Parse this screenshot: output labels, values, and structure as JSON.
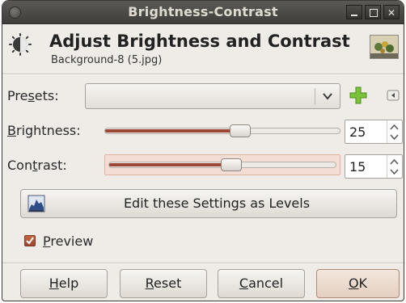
{
  "window": {
    "title": "Brightness-Contrast"
  },
  "header": {
    "title": "Adjust Brightness and Contrast",
    "subtitle": "Background-8 (5.jpg)"
  },
  "presets": {
    "label_pre": "Pre",
    "label_mnemonic": "s",
    "label_post": "ets:",
    "value": ""
  },
  "brightness": {
    "label_mnemonic": "B",
    "label_post": "rightness:",
    "value": "25",
    "min": -127,
    "max": 127
  },
  "contrast": {
    "label_pre": "Con",
    "label_mnemonic": "t",
    "label_post": "rast:",
    "value": "15",
    "min": -127,
    "max": 127
  },
  "levels_button": {
    "label": "Edit these Settings as Levels"
  },
  "preview": {
    "label_mnemonic": "P",
    "label_post": "review",
    "checked": true
  },
  "buttons": {
    "help_mnemonic": "H",
    "help_post": "elp",
    "reset_mnemonic": "R",
    "reset_post": "eset",
    "cancel_mnemonic": "C",
    "cancel_post": "ancel",
    "ok_mnemonic": "O",
    "ok_post": "K"
  },
  "colors": {
    "accent": "#9e4634",
    "window_bg": "#efebe7",
    "titlebar": "#3f3e3a"
  },
  "icons": {
    "header": "brightness-contrast-icon",
    "add": "plus-icon",
    "menu": "menu-arrow-icon",
    "levels": "levels-icon",
    "dropdown": "chevron-down-icon"
  }
}
